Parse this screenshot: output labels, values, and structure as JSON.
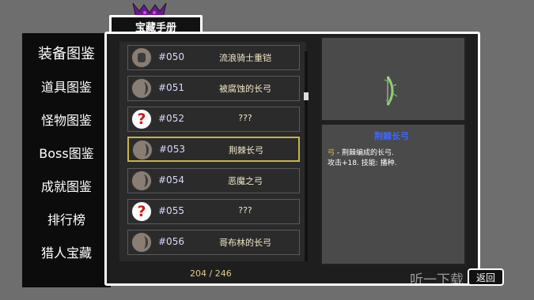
{
  "window": {
    "title": "宝藏手册"
  },
  "sidebar": {
    "items": [
      {
        "label": "装备图鉴",
        "active": true
      },
      {
        "label": "道具图鉴",
        "active": false
      },
      {
        "label": "怪物图鉴",
        "active": false
      },
      {
        "label": "Boss图鉴",
        "active": false
      },
      {
        "label": "成就图鉴",
        "active": false
      },
      {
        "label": "排行榜",
        "active": false
      },
      {
        "label": "猎人宝藏",
        "active": false
      }
    ]
  },
  "list": {
    "rows": [
      {
        "number": "#050",
        "name": "流浪骑士重铠",
        "icon": "armor-icon"
      },
      {
        "number": "#051",
        "name": "被腐蚀的长弓",
        "icon": "bow-icon"
      },
      {
        "number": "#052",
        "name": "???",
        "icon": "question-mark-icon"
      },
      {
        "number": "#053",
        "name": "荆棘长弓",
        "icon": "bow-icon",
        "selected": true
      },
      {
        "number": "#054",
        "name": "恶魔之弓",
        "icon": "bow-icon"
      },
      {
        "number": "#055",
        "name": "???",
        "icon": "question-mark-icon"
      },
      {
        "number": "#056",
        "name": "哥布林的长弓",
        "icon": "bow-icon"
      }
    ],
    "count": "204 / 246"
  },
  "detail": {
    "title": "荆棘长弓",
    "line1_keyword": "弓",
    "line1_rest": " - 荆棘编成的长弓.",
    "line2": "攻击+18. 技能: 播种."
  },
  "back_button": {
    "label": "返回"
  },
  "watermark": {
    "text": "听一下载"
  },
  "colors": {
    "selected_border": "#c7b44a",
    "item_name": "#f2e6c8",
    "item_number": "#d9d9ff",
    "detail_title": "#3f68ff",
    "keyword": "#e8c440"
  }
}
